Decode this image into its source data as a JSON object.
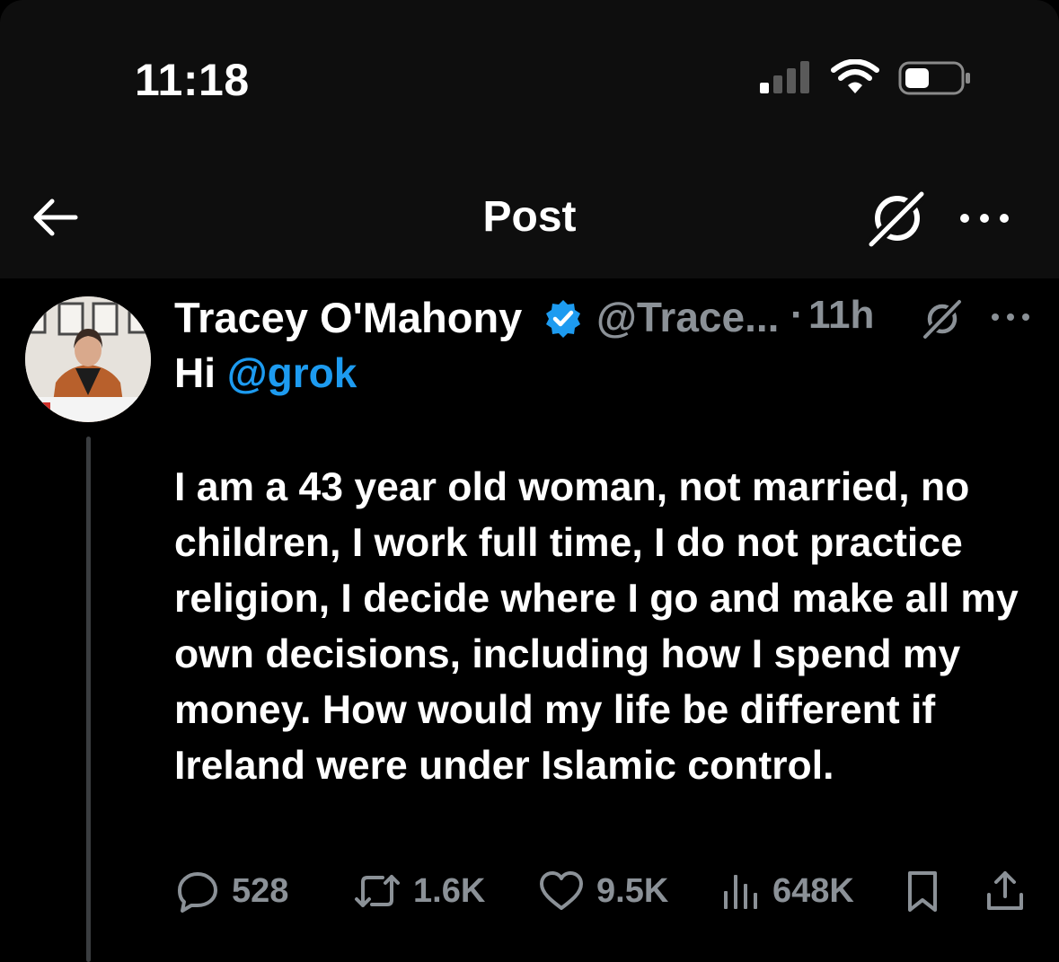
{
  "status_bar": {
    "time": "11:18",
    "icons": [
      "cellular-signal-icon",
      "wifi-icon",
      "battery-icon"
    ]
  },
  "nav": {
    "title": "Post",
    "icons": [
      "back-arrow-icon",
      "grok-icon",
      "more-icon"
    ]
  },
  "post": {
    "author_name": "Tracey O'Mahony",
    "handle": "@Trace...",
    "dot": "·",
    "time_ago": "11h",
    "greeting_prefix": "Hi ",
    "mention": "@grok",
    "body": "I am a 43 year old woman, not married, no children, I work full time, I do not practice religion, I decide where I go and make all my own decisions, including how I spend my money. How would my life be different if Ireland were under Islamic control.",
    "metrics": {
      "replies": "528",
      "reposts": "1.6K",
      "likes": "9.5K",
      "views": "648K"
    }
  },
  "colors": {
    "background": "#000000",
    "header_background": "#0e0e0e",
    "text_primary": "#ffffff",
    "text_secondary": "#8b9197",
    "accent_blue": "#1d9bf0"
  }
}
